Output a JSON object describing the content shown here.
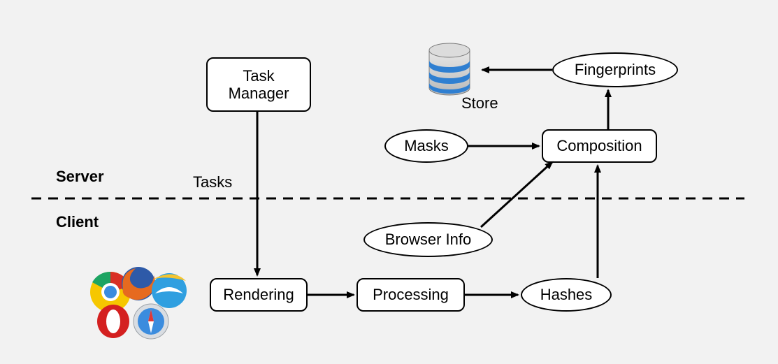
{
  "regions": {
    "server": "Server",
    "client": "Client"
  },
  "labels": {
    "tasks": "Tasks",
    "store": "Store"
  },
  "nodes": {
    "task_manager": "Task\nManager",
    "rendering": "Rendering",
    "processing": "Processing",
    "masks": "Masks",
    "browser_info": "Browser Info",
    "hashes": "Hashes",
    "composition": "Composition",
    "fingerprints": "Fingerprints"
  },
  "icons": {
    "database": "database-icon",
    "browsers": "browser-logos"
  },
  "edges": [
    {
      "from": "task_manager",
      "to": "rendering",
      "label": "Tasks"
    },
    {
      "from": "rendering",
      "to": "processing"
    },
    {
      "from": "processing",
      "to": "hashes"
    },
    {
      "from": "hashes",
      "to": "composition"
    },
    {
      "from": "browser_info",
      "to": "composition"
    },
    {
      "from": "masks",
      "to": "composition"
    },
    {
      "from": "composition",
      "to": "fingerprints"
    },
    {
      "from": "fingerprints",
      "to": "database",
      "label": "Store"
    }
  ]
}
